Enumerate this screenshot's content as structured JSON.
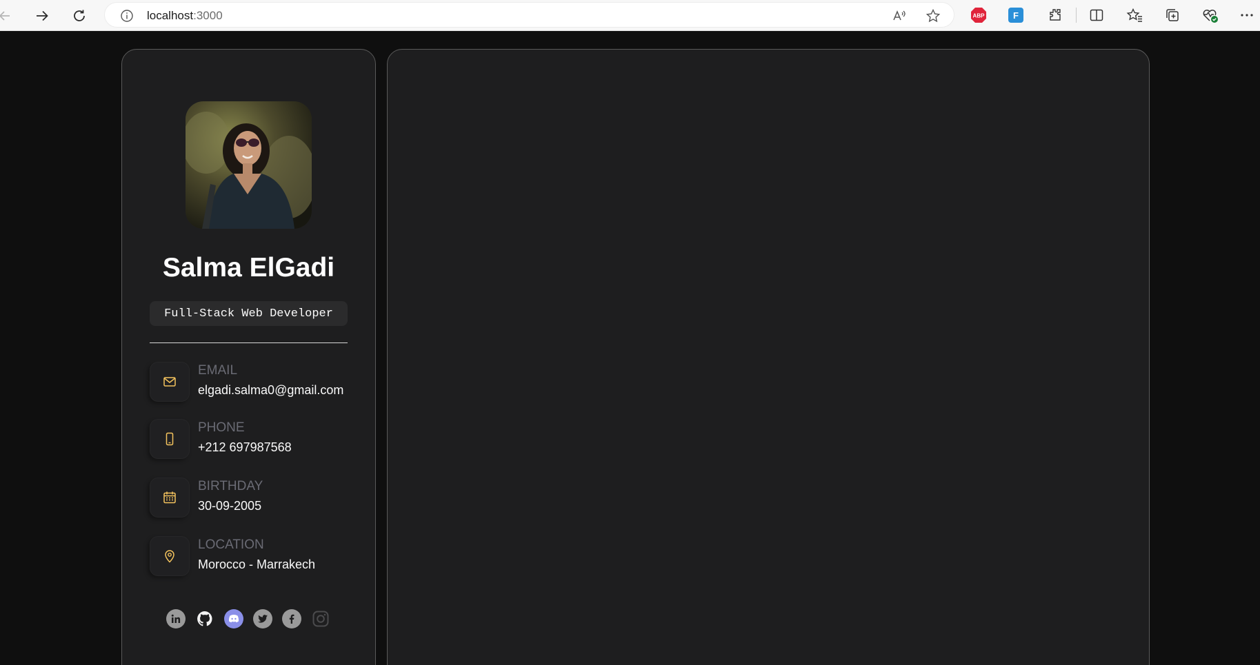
{
  "browser": {
    "url_host": "localhost",
    "url_port": ":3000"
  },
  "profile": {
    "name": "Salma ElGadi",
    "title": "Full-Stack Web Developer"
  },
  "contacts": [
    {
      "label": "EMAIL",
      "value": "elgadi.salma0@gmail.com",
      "icon": "mail-icon"
    },
    {
      "label": "PHONE",
      "value": "+212 697987568",
      "icon": "phone-icon"
    },
    {
      "label": "BIRTHDAY",
      "value": "30-09-2005",
      "icon": "calendar-icon"
    },
    {
      "label": "LOCATION",
      "value": "Morocco - Marrakech",
      "icon": "location-pin-icon"
    }
  ],
  "socials": [
    "linkedin-icon",
    "github-icon",
    "discord-icon",
    "twitter-icon",
    "facebook-icon",
    "instagram-icon"
  ],
  "colors": {
    "page_bg": "#0f0f0f",
    "card_bg": "#1e1e1f",
    "accent_gold": "#f5c45e",
    "label_gray": "#6a6b74"
  }
}
